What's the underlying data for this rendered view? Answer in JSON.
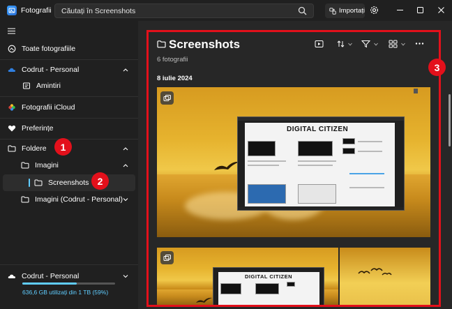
{
  "app": {
    "title": "Fotografii"
  },
  "search": {
    "placeholder": "Căutați în Screenshots"
  },
  "toolbar": {
    "import_label": "Importați"
  },
  "sidebar": {
    "all_photos": "Toate fotografiile",
    "onedrive_account": "Codrut - Personal",
    "memories": "Amintiri",
    "icloud": "Fotografii iCloud",
    "favorites": "Preferințe",
    "folders": "Foldere",
    "images": "Imagini",
    "screenshots": "Screenshots",
    "images_onedrive": "Imagini (Codrut - Personal)"
  },
  "storage": {
    "account": "Codrut - Personal",
    "usage_text": "636,6 GB utilizați din 1 TB (59%)",
    "used_fraction": 0.59
  },
  "main": {
    "folder_title": "Screenshots",
    "photo_count": "6 fotografii",
    "date_header": "8 iulie 2024"
  },
  "thumbnail": {
    "brand_text": "DIGITAL CITIZEN"
  },
  "callouts": [
    "1",
    "2",
    "3"
  ],
  "colors": {
    "accent": "#60cdff",
    "callout_red": "#e3101b",
    "background": "#202020"
  }
}
